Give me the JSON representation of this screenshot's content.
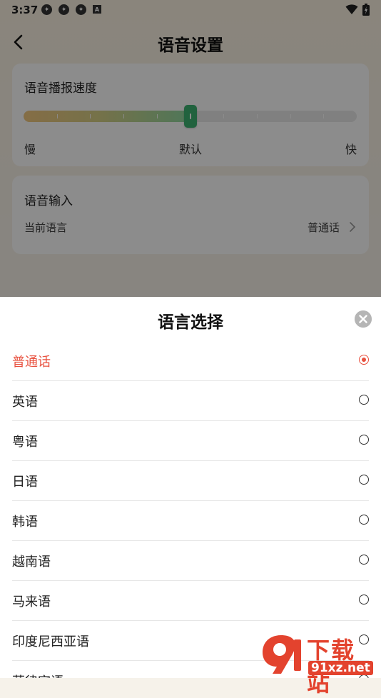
{
  "status_bar": {
    "time": "3:37",
    "small_a": "A"
  },
  "header": {
    "title": "语音设置"
  },
  "speed_card": {
    "title": "语音播报速度",
    "slow_label": "慢",
    "default_label": "默认",
    "fast_label": "快",
    "level": 0.5
  },
  "input_card": {
    "title": "语音输入",
    "row_label": "当前语言",
    "row_value": "普通话"
  },
  "sheet": {
    "title": "语言选择",
    "languages": [
      {
        "label": "普通话",
        "selected": true
      },
      {
        "label": "英语",
        "selected": false
      },
      {
        "label": "粤语",
        "selected": false
      },
      {
        "label": "日语",
        "selected": false
      },
      {
        "label": "韩语",
        "selected": false
      },
      {
        "label": "越南语",
        "selected": false
      },
      {
        "label": "马来语",
        "selected": false
      },
      {
        "label": "印度尼西亚语",
        "selected": false
      },
      {
        "label": "菲律宾语",
        "selected": false
      }
    ]
  },
  "watermark": {
    "main": "下载站",
    "sub": "91xz.net"
  },
  "colors": {
    "accent_red": "#e8503e",
    "slider_green": "#3cb371",
    "overlay": "rgba(0,0,0,0.45)"
  }
}
